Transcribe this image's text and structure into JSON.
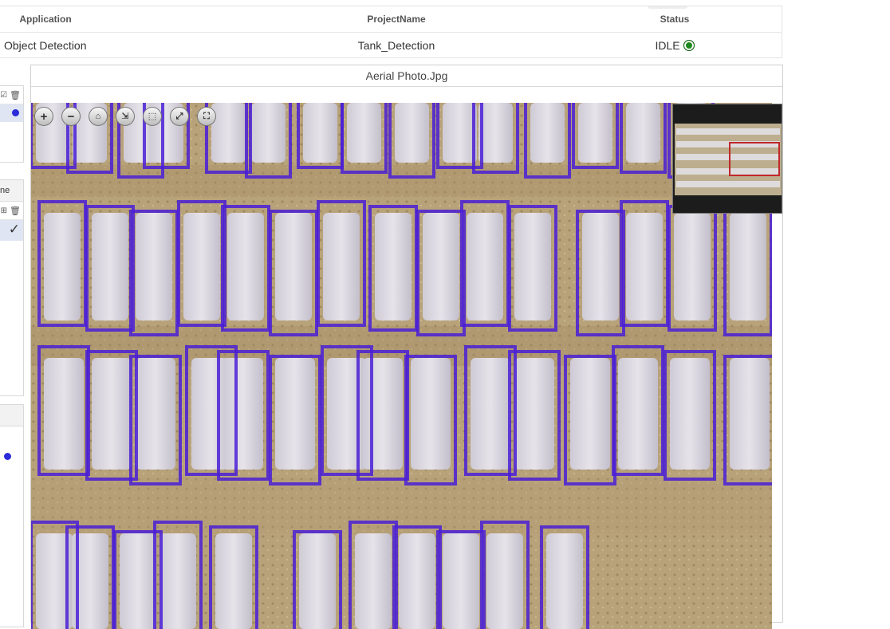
{
  "table": {
    "headers": {
      "application": "Application",
      "project_name": "ProjectName",
      "status": "Status"
    },
    "row": {
      "application": "Object Detection",
      "project_name": "Tank_Detection",
      "status": "IDLE"
    },
    "status_color": "#1e8a1e"
  },
  "left_panel": {
    "middle_header_text": "ne"
  },
  "viewer": {
    "title": "Aerial Photo.Jpg",
    "zoom_tools": [
      "zoom-in-icon",
      "zoom-out-icon",
      "home-icon",
      "fit-icon",
      "select-icon",
      "resize-icon",
      "fullscreen-icon"
    ],
    "box_color": "#4a1fd6",
    "navigator_highlight_color": "#c0282a"
  }
}
